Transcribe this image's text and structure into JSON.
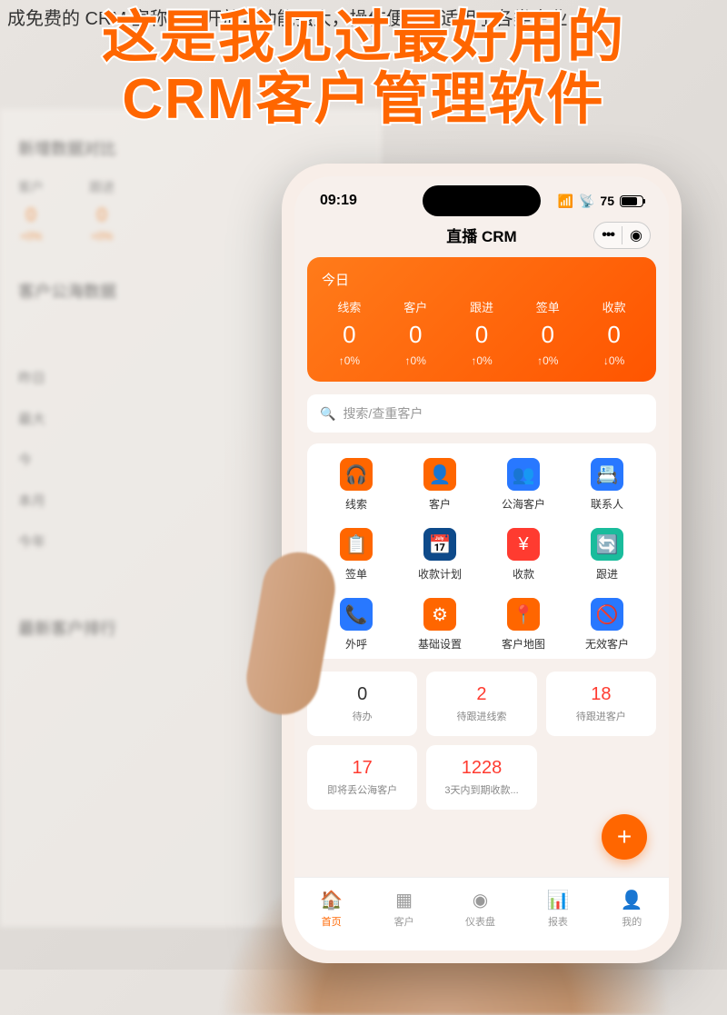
{
  "caption_top": "成免费的 CRM 宣称免费开放，功能强大，操作便捷，适用于各类企业",
  "headline_line1": "这是我见过最好用的",
  "headline_line2": "CRM客户管理软件",
  "desktop": {
    "section1_title": "新增数据对比",
    "cols": [
      {
        "label": "客户",
        "value": "0",
        "pct": "+0%"
      },
      {
        "label": "跟进",
        "value": "0",
        "pct": "+0%"
      }
    ],
    "section2_title": "客户公海数据",
    "list": [
      "昨日",
      "最大",
      "今",
      "本月",
      "今年"
    ],
    "section3_title": "最新客户排行"
  },
  "phone": {
    "status": {
      "time": "09:19",
      "battery": "75"
    },
    "app_title": "直播 CRM",
    "stats": {
      "today_label": "今日",
      "items": [
        {
          "label": "线索",
          "value": "0",
          "pct": "↑0%"
        },
        {
          "label": "客户",
          "value": "0",
          "pct": "↑0%"
        },
        {
          "label": "跟进",
          "value": "0",
          "pct": "↑0%"
        },
        {
          "label": "签单",
          "value": "0",
          "pct": "↑0%"
        },
        {
          "label": "收款",
          "value": "0",
          "pct": "↓0%"
        }
      ]
    },
    "search_placeholder": "搜索/查重客户",
    "functions": [
      {
        "label": "线索",
        "icon": "🎧",
        "color": "ic-orange"
      },
      {
        "label": "客户",
        "icon": "👤",
        "color": "ic-orange"
      },
      {
        "label": "公海客户",
        "icon": "👥",
        "color": "ic-blue"
      },
      {
        "label": "联系人",
        "icon": "📇",
        "color": "ic-blue"
      },
      {
        "label": "签单",
        "icon": "📋",
        "color": "ic-orange"
      },
      {
        "label": "收款计划",
        "icon": "📅",
        "color": "ic-dblue"
      },
      {
        "label": "收款",
        "icon": "¥",
        "color": "ic-red"
      },
      {
        "label": "跟进",
        "icon": "🔄",
        "color": "ic-teal"
      },
      {
        "label": "外呼",
        "icon": "📞",
        "color": "ic-blue"
      },
      {
        "label": "基础设置",
        "icon": "⚙",
        "color": "ic-orange"
      },
      {
        "label": "客户地图",
        "icon": "📍",
        "color": "ic-orange"
      },
      {
        "label": "无效客户",
        "icon": "🚫",
        "color": "ic-blue"
      }
    ],
    "data_cards_row1": [
      {
        "value": "0",
        "label": "待办",
        "red": false
      },
      {
        "value": "2",
        "label": "待跟进线索",
        "red": true
      },
      {
        "value": "18",
        "label": "待跟进客户",
        "red": true
      }
    ],
    "data_cards_row2": [
      {
        "value": "17",
        "label": "即将丢公海客户",
        "red": true
      },
      {
        "value": "1228",
        "label": "3天内到期收款...",
        "red": true
      }
    ],
    "nav": [
      {
        "label": "首页",
        "icon": "🏠",
        "active": true
      },
      {
        "label": "客户",
        "icon": "▦",
        "active": false
      },
      {
        "label": "仪表盘",
        "icon": "◉",
        "active": false
      },
      {
        "label": "报表",
        "icon": "📊",
        "active": false
      },
      {
        "label": "我的",
        "icon": "👤",
        "active": false
      }
    ]
  }
}
